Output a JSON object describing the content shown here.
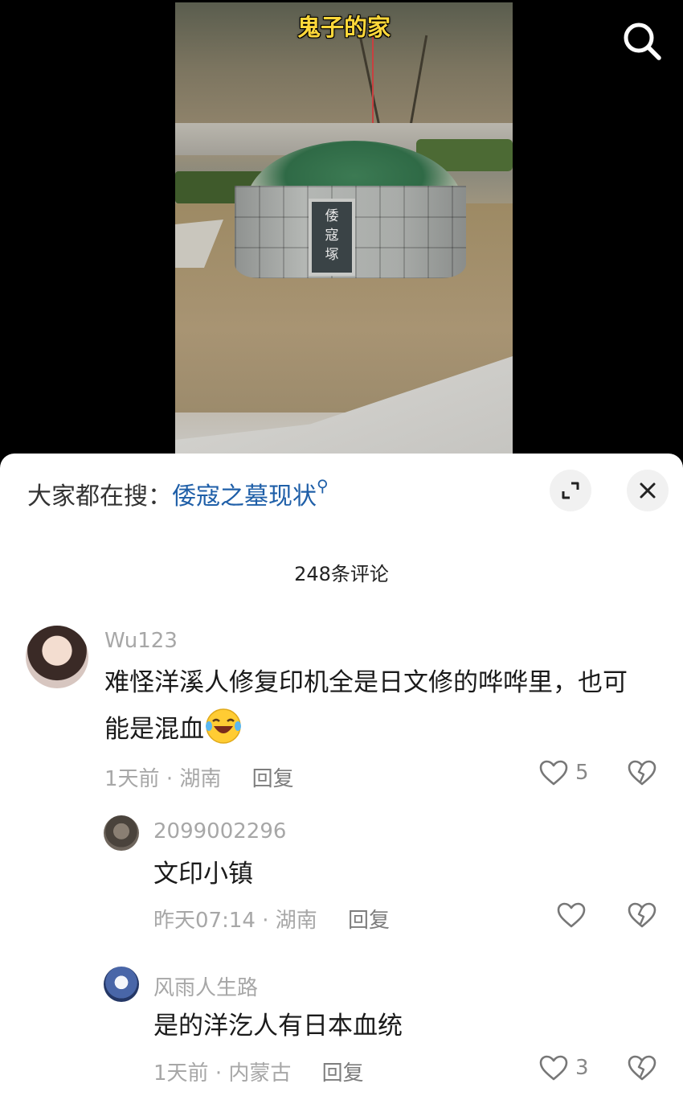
{
  "video": {
    "caption": "鬼子的家",
    "plaque_chars": [
      "倭",
      "寇",
      "塚"
    ]
  },
  "icons": {
    "search": "search-icon",
    "expand": "expand-icon",
    "close": "close-icon",
    "like": "heart-icon",
    "dislike": "broken-heart-icon",
    "emoji": "laughing-tears-emoji"
  },
  "sheet": {
    "trend_prefix": "大家都在搜：",
    "trend_term": "倭寇之墓现状",
    "comment_count": "248条评论"
  },
  "comments": [
    {
      "username": "Wu123",
      "text_line1": "难怪洋溪人修复印机全是日文修的哗哗里，也可",
      "text_line2": "能是混血",
      "time": "1天前",
      "location": "湖南",
      "reply": "回复",
      "likes": "5",
      "dot": "·"
    },
    {
      "username": "2099002296",
      "text": "文印小镇",
      "time": "昨天07:14",
      "location": "湖南",
      "reply": "回复",
      "likes": "",
      "dot": "·"
    },
    {
      "username": "风雨人生路",
      "text": "是的洋汔人有日本血统",
      "time": "1天前",
      "location": "内蒙古",
      "reply": "回复",
      "likes": "3",
      "dot": "·"
    }
  ],
  "colors": {
    "trend_link": "#1f5fa8",
    "caption": "#ffd83a",
    "meta_gray": "#a7a7a7"
  }
}
